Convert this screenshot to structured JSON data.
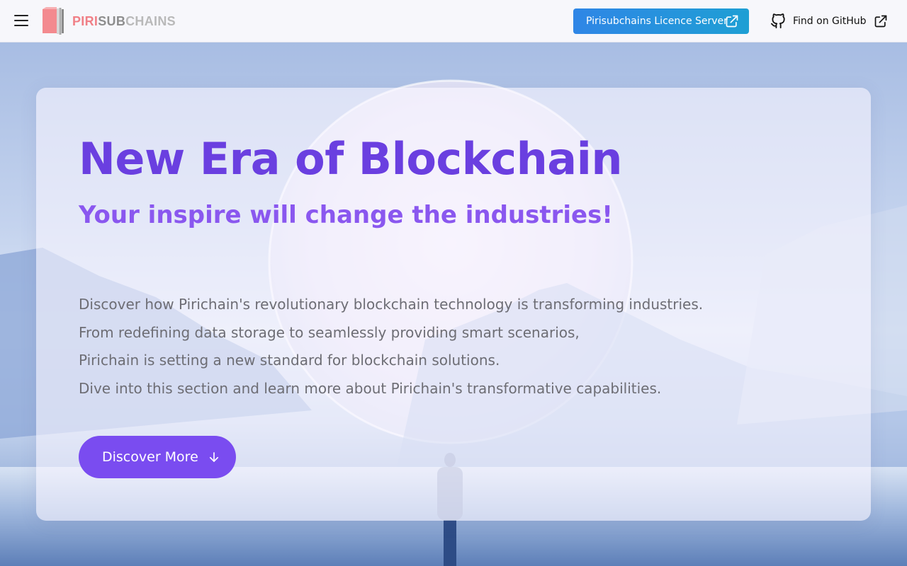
{
  "header": {
    "menu_icon": "hamburger-menu-icon",
    "logo": {
      "part1": "PIRI",
      "part2": "SUB",
      "part3": "CHAINS",
      "colors": [
        "#f07f86",
        "#8d8d8d",
        "#b9b9b9"
      ]
    },
    "licence_button": {
      "label": "Pirisubchains Licence Server",
      "icon": "external-link-icon"
    },
    "github_link": {
      "label": "Find on GitHub",
      "icon": "github-icon",
      "external_icon": "external-link-icon"
    }
  },
  "hero": {
    "title": "New Era of Blockchain",
    "subtitle": "Your inspire will change the industries!",
    "description": [
      "Discover how Pirichain's revolutionary blockchain technology is transforming industries.",
      "From redefining data storage to seamlessly providing smart scenarios,",
      "Pirichain is setting a new standard for blockchain solutions.",
      "Dive into this section and learn more about Pirichain's transformative capabilities."
    ],
    "cta": {
      "label": "Discover More",
      "icon": "arrow-down-icon"
    }
  },
  "colors": {
    "title": "#6a3fe0",
    "subtitle": "#8a57ef",
    "cta": "#7a4cf0",
    "licence_button": "#2f86e6"
  }
}
